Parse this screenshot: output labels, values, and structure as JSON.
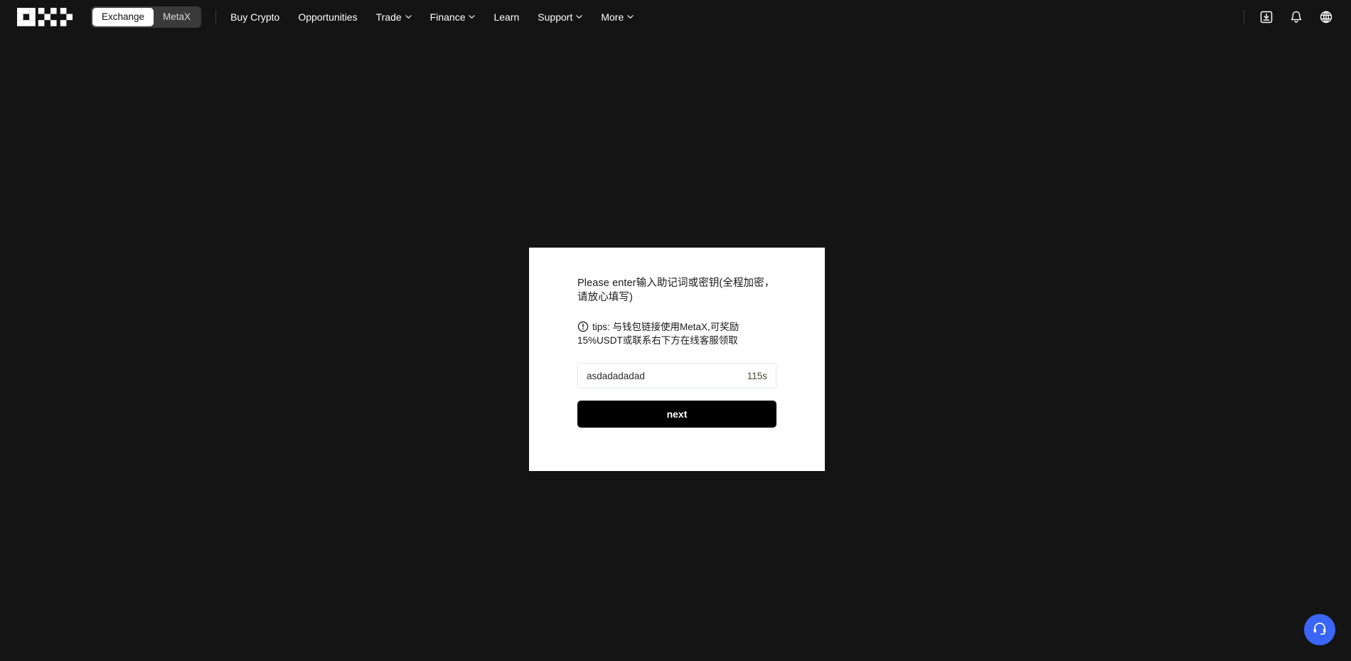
{
  "header": {
    "logo_alt": "OKX",
    "switcher": [
      {
        "label": "Exchange",
        "active": true
      },
      {
        "label": "MetaX",
        "active": false
      }
    ],
    "nav": [
      {
        "label": "Buy Crypto",
        "has_caret": false
      },
      {
        "label": "Opportunities",
        "has_caret": false
      },
      {
        "label": "Trade",
        "has_caret": true
      },
      {
        "label": "Finance",
        "has_caret": true
      },
      {
        "label": "Learn",
        "has_caret": false
      },
      {
        "label": "Support",
        "has_caret": true
      },
      {
        "label": "More",
        "has_caret": true
      }
    ],
    "actions": [
      {
        "icon": "download-app-icon"
      },
      {
        "icon": "bell-icon"
      },
      {
        "icon": "globe-icon"
      }
    ]
  },
  "card": {
    "title": "Please enter输入助记词或密钥(全程加密，请放心填写)",
    "tips_icon": "exclamation-circle-icon",
    "tips_text": "tips: 与钱包链接使用MetaX,可奖励15%USDT或联系右下方在线客服领取",
    "input": {
      "value": "asdadadadad",
      "placeholder": "",
      "timer": "115s"
    },
    "submit_label": "next"
  },
  "support": {
    "icon": "headset-icon"
  },
  "colors": {
    "page_background": "#141414",
    "card_background": "#ffffff",
    "accent_blue": "#3b65f5",
    "button_black": "#000000",
    "input_border": "#e3e6e8"
  }
}
